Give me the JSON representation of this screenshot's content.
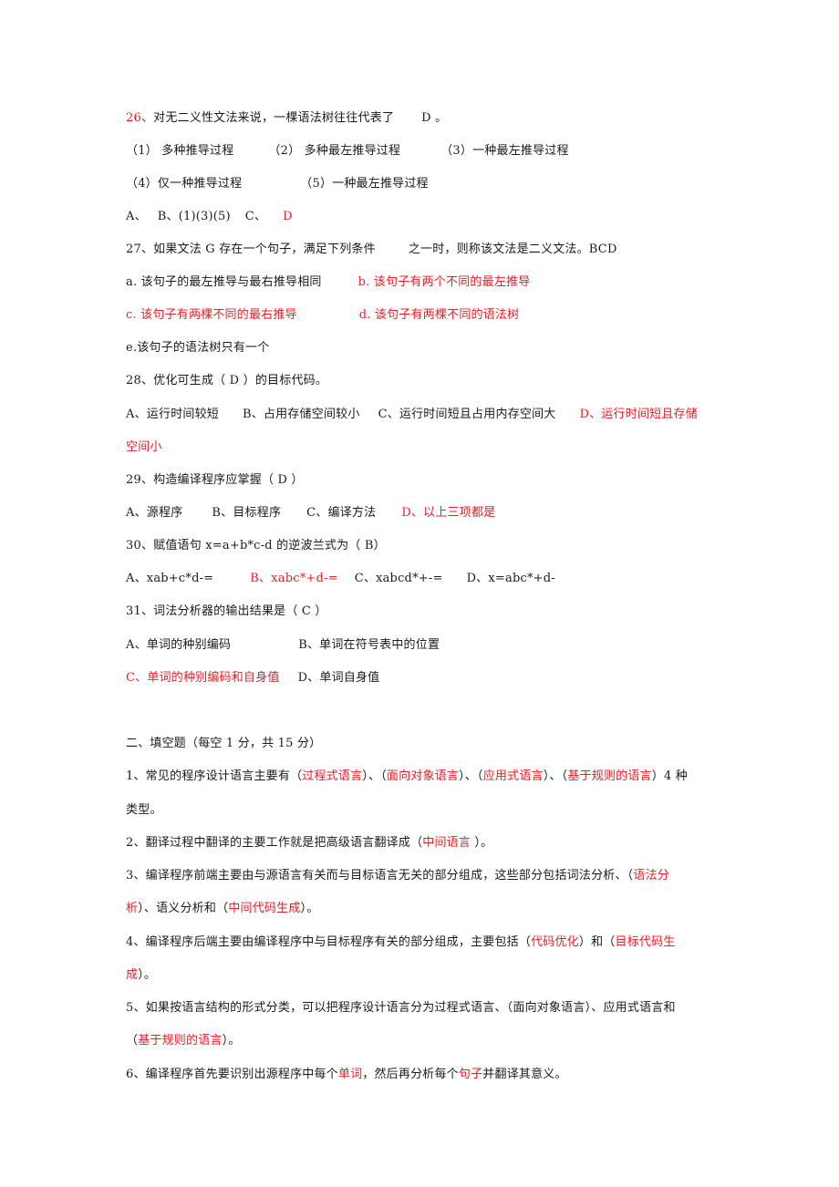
{
  "document": {
    "accent_color": "#ee1c24",
    "questions": {
      "q26": {
        "number": "26、",
        "stem": "对无二义性文法来说，一棵语法树往往代表了",
        "answer": "D 。",
        "options_row1": [
          "（1） 多种推导过程",
          "（2） 多种最左推导过程",
          "（3）一种最左推导过程"
        ],
        "options_row2": [
          "（4）仅一种推导过程",
          "（5）一种最左推导过程"
        ],
        "choices": {
          "a": "A、",
          "b": "B、(1)(3)(5)",
          "c": "C、",
          "d": "D"
        }
      },
      "q27": {
        "stem": "27、如果文法 G 存在一个句子，满足下列条件",
        "stem_tail": "之一时，则称该文法是二义文法。BCD",
        "a": "a. 该句子的最左推导与最右推导相同",
        "b": "b. 该句子有两个不同的最左推导",
        "c": "c. 该句子有两棵不同的最右推导",
        "d": "d. 该句子有两棵不同的语法树",
        "e": "e.该句子的语法树只有一个"
      },
      "q28": {
        "stem": "28、优化可生成（   D   ）的目标代码。",
        "a": "A、运行时间较短",
        "b": "B、占用存储空间较小",
        "c": "C、运行时间短且占用内存空间大",
        "d": "D、运行时间短且存储",
        "d_cont": "空间小"
      },
      "q29": {
        "stem": "29、构造编译程序应掌握（  D   ）",
        "a": "A、源程序",
        "b": "B、目标程序",
        "c": "C、编译方法",
        "d": "D、以上三项都是"
      },
      "q30": {
        "stem": "30、赋值语句 x=a+b*c-d 的逆波兰式为（   B）",
        "a": "A、xab+c*d-=",
        "b": "B、xabc*+d-=",
        "c": "C、xabcd*+-=",
        "d": "D、x=abc*+d-"
      },
      "q31": {
        "stem": "31、词法分析器的输出结果是（  C   ）",
        "a": "A、单词的种别编码",
        "b": "B、单词在符号表中的位置",
        "c": "C、单词的种别编码和自身值",
        "d": "D、单词自身值"
      }
    },
    "section2": {
      "title": "二、填空题（每空 1 分，共 15 分）",
      "f1": {
        "p1": "1、常见的程序设计语言主要有（",
        "a1": "过程式语言",
        "p2": "）、（",
        "a2": "面向对象语言",
        "p3": "）、（",
        "a3": "应用式语言",
        "p4": "）、（",
        "a4": "基于规则的语言",
        "p5": "）4 种",
        "cont": "类型。"
      },
      "f2": {
        "p1": "2、翻译过程中翻译的主要工作就是把高级语言翻译成（",
        "a1": "中间语言",
        "p2": " ）。"
      },
      "f3": {
        "p1": "3、编译程序前端主要由与源语言有关而与目标语言无关的部分组成，这些部分包括词法分析、（",
        "a1": "语法分",
        "a1_cont": "析",
        "p2": "）、语义分析和（",
        "a2": "中间代码生成",
        "p3": "）。"
      },
      "f4": {
        "p1": "4、编译程序后端主要由编译程序中与目标程序有关的部分组成，主要包括（",
        "a1": "代码优化",
        "p2": "）和（",
        "a2": "目标代码生",
        "a2_cont": "成",
        "p3": "）。"
      },
      "f5": {
        "p1": "5、如果按语言结构的形式分类，可以把程序设计语言分为过程式语言、（面向对象语言）、应用式语言和",
        "p2": "（",
        "a1": "基于规则的语言",
        "p3": "）。"
      },
      "f6": {
        "p1": "6、编译程序首先要识别出源程序中每个",
        "a1": "单词",
        "p2": "，然后再分析每个",
        "a2": "句子",
        "p3": "并翻译其意义。"
      }
    }
  }
}
